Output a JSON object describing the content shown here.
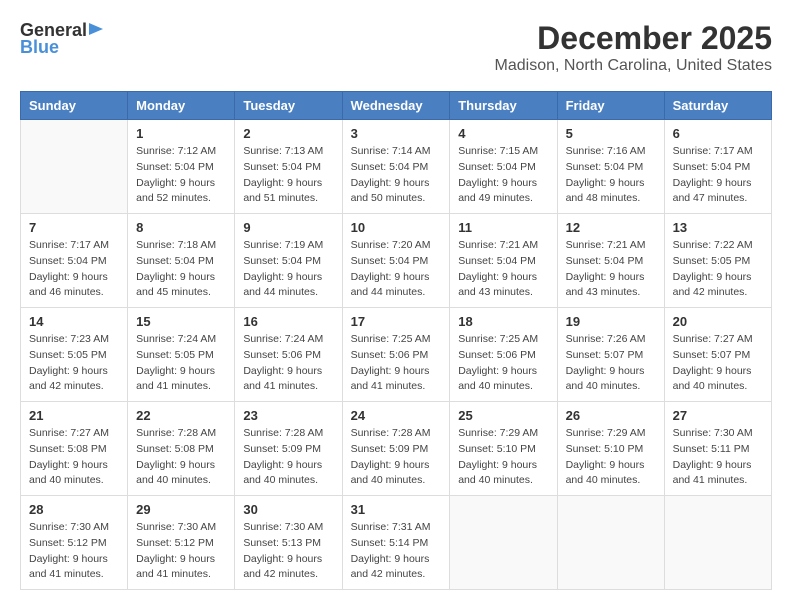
{
  "header": {
    "logo_general": "General",
    "logo_blue": "Blue",
    "month": "December 2025",
    "location": "Madison, North Carolina, United States"
  },
  "days_of_week": [
    "Sunday",
    "Monday",
    "Tuesday",
    "Wednesday",
    "Thursday",
    "Friday",
    "Saturday"
  ],
  "weeks": [
    [
      {
        "day": "",
        "sunrise": "",
        "sunset": "",
        "daylight": ""
      },
      {
        "day": "1",
        "sunrise": "Sunrise: 7:12 AM",
        "sunset": "Sunset: 5:04 PM",
        "daylight": "Daylight: 9 hours and 52 minutes."
      },
      {
        "day": "2",
        "sunrise": "Sunrise: 7:13 AM",
        "sunset": "Sunset: 5:04 PM",
        "daylight": "Daylight: 9 hours and 51 minutes."
      },
      {
        "day": "3",
        "sunrise": "Sunrise: 7:14 AM",
        "sunset": "Sunset: 5:04 PM",
        "daylight": "Daylight: 9 hours and 50 minutes."
      },
      {
        "day": "4",
        "sunrise": "Sunrise: 7:15 AM",
        "sunset": "Sunset: 5:04 PM",
        "daylight": "Daylight: 9 hours and 49 minutes."
      },
      {
        "day": "5",
        "sunrise": "Sunrise: 7:16 AM",
        "sunset": "Sunset: 5:04 PM",
        "daylight": "Daylight: 9 hours and 48 minutes."
      },
      {
        "day": "6",
        "sunrise": "Sunrise: 7:17 AM",
        "sunset": "Sunset: 5:04 PM",
        "daylight": "Daylight: 9 hours and 47 minutes."
      }
    ],
    [
      {
        "day": "7",
        "sunrise": "Sunrise: 7:17 AM",
        "sunset": "Sunset: 5:04 PM",
        "daylight": "Daylight: 9 hours and 46 minutes."
      },
      {
        "day": "8",
        "sunrise": "Sunrise: 7:18 AM",
        "sunset": "Sunset: 5:04 PM",
        "daylight": "Daylight: 9 hours and 45 minutes."
      },
      {
        "day": "9",
        "sunrise": "Sunrise: 7:19 AM",
        "sunset": "Sunset: 5:04 PM",
        "daylight": "Daylight: 9 hours and 44 minutes."
      },
      {
        "day": "10",
        "sunrise": "Sunrise: 7:20 AM",
        "sunset": "Sunset: 5:04 PM",
        "daylight": "Daylight: 9 hours and 44 minutes."
      },
      {
        "day": "11",
        "sunrise": "Sunrise: 7:21 AM",
        "sunset": "Sunset: 5:04 PM",
        "daylight": "Daylight: 9 hours and 43 minutes."
      },
      {
        "day": "12",
        "sunrise": "Sunrise: 7:21 AM",
        "sunset": "Sunset: 5:04 PM",
        "daylight": "Daylight: 9 hours and 43 minutes."
      },
      {
        "day": "13",
        "sunrise": "Sunrise: 7:22 AM",
        "sunset": "Sunset: 5:05 PM",
        "daylight": "Daylight: 9 hours and 42 minutes."
      }
    ],
    [
      {
        "day": "14",
        "sunrise": "Sunrise: 7:23 AM",
        "sunset": "Sunset: 5:05 PM",
        "daylight": "Daylight: 9 hours and 42 minutes."
      },
      {
        "day": "15",
        "sunrise": "Sunrise: 7:24 AM",
        "sunset": "Sunset: 5:05 PM",
        "daylight": "Daylight: 9 hours and 41 minutes."
      },
      {
        "day": "16",
        "sunrise": "Sunrise: 7:24 AM",
        "sunset": "Sunset: 5:06 PM",
        "daylight": "Daylight: 9 hours and 41 minutes."
      },
      {
        "day": "17",
        "sunrise": "Sunrise: 7:25 AM",
        "sunset": "Sunset: 5:06 PM",
        "daylight": "Daylight: 9 hours and 41 minutes."
      },
      {
        "day": "18",
        "sunrise": "Sunrise: 7:25 AM",
        "sunset": "Sunset: 5:06 PM",
        "daylight": "Daylight: 9 hours and 40 minutes."
      },
      {
        "day": "19",
        "sunrise": "Sunrise: 7:26 AM",
        "sunset": "Sunset: 5:07 PM",
        "daylight": "Daylight: 9 hours and 40 minutes."
      },
      {
        "day": "20",
        "sunrise": "Sunrise: 7:27 AM",
        "sunset": "Sunset: 5:07 PM",
        "daylight": "Daylight: 9 hours and 40 minutes."
      }
    ],
    [
      {
        "day": "21",
        "sunrise": "Sunrise: 7:27 AM",
        "sunset": "Sunset: 5:08 PM",
        "daylight": "Daylight: 9 hours and 40 minutes."
      },
      {
        "day": "22",
        "sunrise": "Sunrise: 7:28 AM",
        "sunset": "Sunset: 5:08 PM",
        "daylight": "Daylight: 9 hours and 40 minutes."
      },
      {
        "day": "23",
        "sunrise": "Sunrise: 7:28 AM",
        "sunset": "Sunset: 5:09 PM",
        "daylight": "Daylight: 9 hours and 40 minutes."
      },
      {
        "day": "24",
        "sunrise": "Sunrise: 7:28 AM",
        "sunset": "Sunset: 5:09 PM",
        "daylight": "Daylight: 9 hours and 40 minutes."
      },
      {
        "day": "25",
        "sunrise": "Sunrise: 7:29 AM",
        "sunset": "Sunset: 5:10 PM",
        "daylight": "Daylight: 9 hours and 40 minutes."
      },
      {
        "day": "26",
        "sunrise": "Sunrise: 7:29 AM",
        "sunset": "Sunset: 5:10 PM",
        "daylight": "Daylight: 9 hours and 40 minutes."
      },
      {
        "day": "27",
        "sunrise": "Sunrise: 7:30 AM",
        "sunset": "Sunset: 5:11 PM",
        "daylight": "Daylight: 9 hours and 41 minutes."
      }
    ],
    [
      {
        "day": "28",
        "sunrise": "Sunrise: 7:30 AM",
        "sunset": "Sunset: 5:12 PM",
        "daylight": "Daylight: 9 hours and 41 minutes."
      },
      {
        "day": "29",
        "sunrise": "Sunrise: 7:30 AM",
        "sunset": "Sunset: 5:12 PM",
        "daylight": "Daylight: 9 hours and 41 minutes."
      },
      {
        "day": "30",
        "sunrise": "Sunrise: 7:30 AM",
        "sunset": "Sunset: 5:13 PM",
        "daylight": "Daylight: 9 hours and 42 minutes."
      },
      {
        "day": "31",
        "sunrise": "Sunrise: 7:31 AM",
        "sunset": "Sunset: 5:14 PM",
        "daylight": "Daylight: 9 hours and 42 minutes."
      },
      {
        "day": "",
        "sunrise": "",
        "sunset": "",
        "daylight": ""
      },
      {
        "day": "",
        "sunrise": "",
        "sunset": "",
        "daylight": ""
      },
      {
        "day": "",
        "sunrise": "",
        "sunset": "",
        "daylight": ""
      }
    ]
  ]
}
